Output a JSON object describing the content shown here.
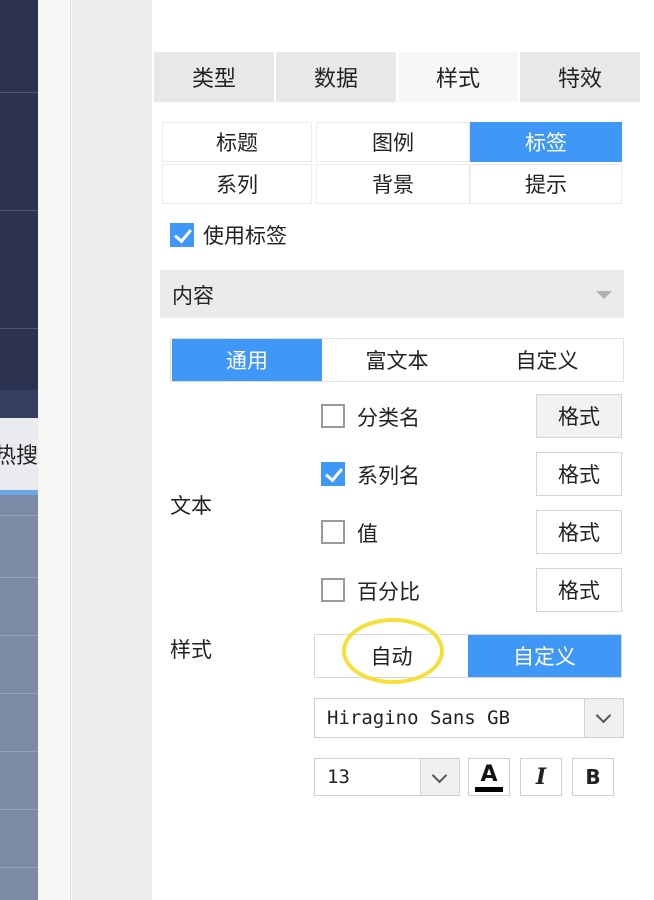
{
  "background": {
    "strip_partial_text": "热搜月"
  },
  "main_tabs": [
    {
      "label": "类型",
      "active": false
    },
    {
      "label": "数据",
      "active": false
    },
    {
      "label": "样式",
      "active": true
    },
    {
      "label": "特效",
      "active": false
    }
  ],
  "sub_tabs": [
    {
      "label": "标题",
      "active": false
    },
    {
      "label": "图例",
      "active": false
    },
    {
      "label": "标签",
      "active": true
    },
    {
      "label": "系列",
      "active": false
    },
    {
      "label": "背景",
      "active": false
    },
    {
      "label": "提示",
      "active": false
    }
  ],
  "use_label": {
    "label": "使用标签",
    "checked": true
  },
  "content_section": {
    "title": "内容"
  },
  "content_tabs": [
    {
      "label": "通用",
      "active": true
    },
    {
      "label": "富文本",
      "active": false
    },
    {
      "label": "自定义",
      "active": false
    }
  ],
  "text_section": {
    "label": "文本",
    "options": [
      {
        "label": "分类名",
        "checked": false,
        "button": "格式"
      },
      {
        "label": "系列名",
        "checked": true,
        "button": "格式"
      },
      {
        "label": "值",
        "checked": false,
        "button": "格式"
      },
      {
        "label": "百分比",
        "checked": false,
        "button": "格式"
      }
    ]
  },
  "style_section": {
    "label": "样式",
    "options": [
      {
        "label": "自动",
        "active": false
      },
      {
        "label": "自定义",
        "active": true
      }
    ],
    "font_family": "Hiragino Sans GB",
    "font_size": "13",
    "tools": {
      "color_glyph": "A",
      "italic_glyph": "I",
      "bold_glyph": "B"
    }
  },
  "colors": {
    "accent": "#3f98f7",
    "highlight_circle": "#f5e03a"
  }
}
